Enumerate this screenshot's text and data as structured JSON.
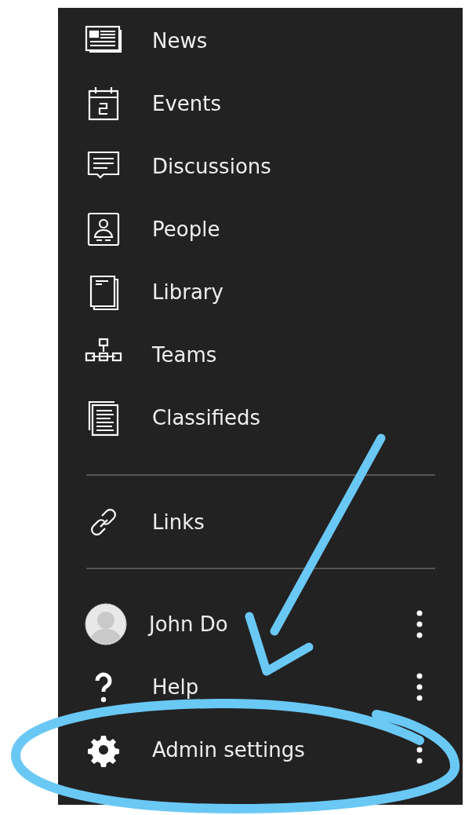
{
  "main_items": [
    {
      "label": "News"
    },
    {
      "label": "Events"
    },
    {
      "label": "Discussions"
    },
    {
      "label": "People"
    },
    {
      "label": "Library"
    },
    {
      "label": "Teams"
    },
    {
      "label": "Classifieds"
    }
  ],
  "link_items": [
    {
      "label": "Links"
    }
  ],
  "account_items": [
    {
      "kind": "user",
      "label": "John Do"
    },
    {
      "kind": "help",
      "label": "Help"
    },
    {
      "kind": "settings",
      "label": "Admin settings"
    }
  ]
}
